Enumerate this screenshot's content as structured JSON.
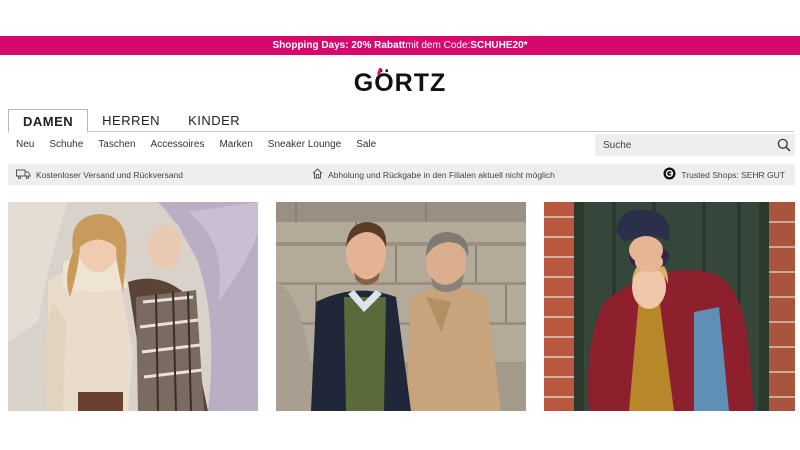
{
  "promo": {
    "part1": "Shopping Days: 20% Rabatt",
    "part2": " mit dem Code: ",
    "code": "SCHUHE20*"
  },
  "brand": {
    "logo": "GÖRTZ"
  },
  "gender_tabs": [
    {
      "label": "DAMEN",
      "active": true
    },
    {
      "label": "HERREN",
      "active": false
    },
    {
      "label": "KINDER",
      "active": false
    }
  ],
  "categories": [
    "Neu",
    "Schuhe",
    "Taschen",
    "Accessoires",
    "Marken",
    "Sneaker Lounge",
    "Sale"
  ],
  "search": {
    "placeholder": "Suche"
  },
  "info": {
    "shipping": "Kostenloser Versand und Rückversand",
    "pickup": "Abholung und Rückgabe in den Filialen aktuell nicht möglich",
    "trusted": "Trusted Shops: SEHR GUT"
  },
  "colors": {
    "accent": "#d6086e",
    "info_bg": "#eeeeee"
  },
  "tiles": [
    {
      "icon": "women-fashion-photo"
    },
    {
      "icon": "men-fashion-photo"
    },
    {
      "icon": "kids-fashion-photo"
    }
  ]
}
